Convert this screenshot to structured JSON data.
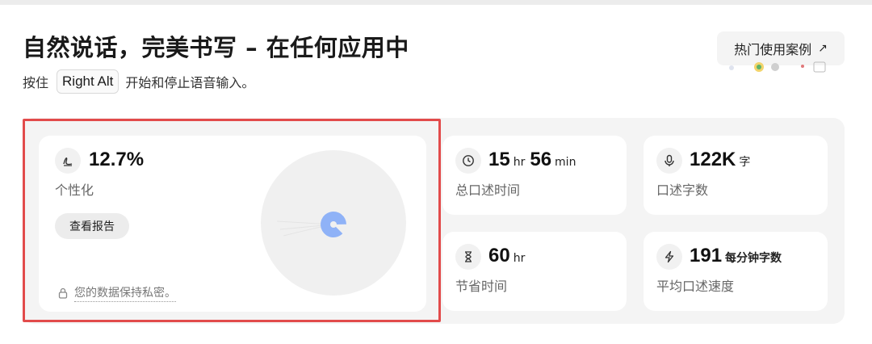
{
  "header": {
    "title": "自然说话，完美书写 – 在任何应用中",
    "subtitle_prefix": "按住",
    "hotkey": "Right Alt",
    "subtitle_suffix": "开始和停止语音输入。",
    "use_cases_label": "热门使用案例",
    "use_cases_icon": "arrow-up-right-icon"
  },
  "personalization": {
    "value": "12.7%",
    "label": "个性化",
    "report_button": "查看报告",
    "privacy_text": "您的数据保持私密。",
    "progress_fraction": 0.127,
    "accent_color": "#8fb2f7"
  },
  "stats": {
    "dictation_time": {
      "hours": "15",
      "hours_unit": "hr",
      "minutes": "56",
      "minutes_unit": "min",
      "label": "总口述时间"
    },
    "words": {
      "value": "122K",
      "unit": "字",
      "label": "口述字数"
    },
    "time_saved": {
      "value": "60",
      "unit": "hr",
      "label": "节省时间"
    },
    "speed": {
      "value": "191",
      "unit": "每分钟字数",
      "label": "平均口述速度"
    }
  },
  "colors": {
    "highlight_border": "#e24b4b",
    "panel_bg": "#f4f4f4"
  }
}
